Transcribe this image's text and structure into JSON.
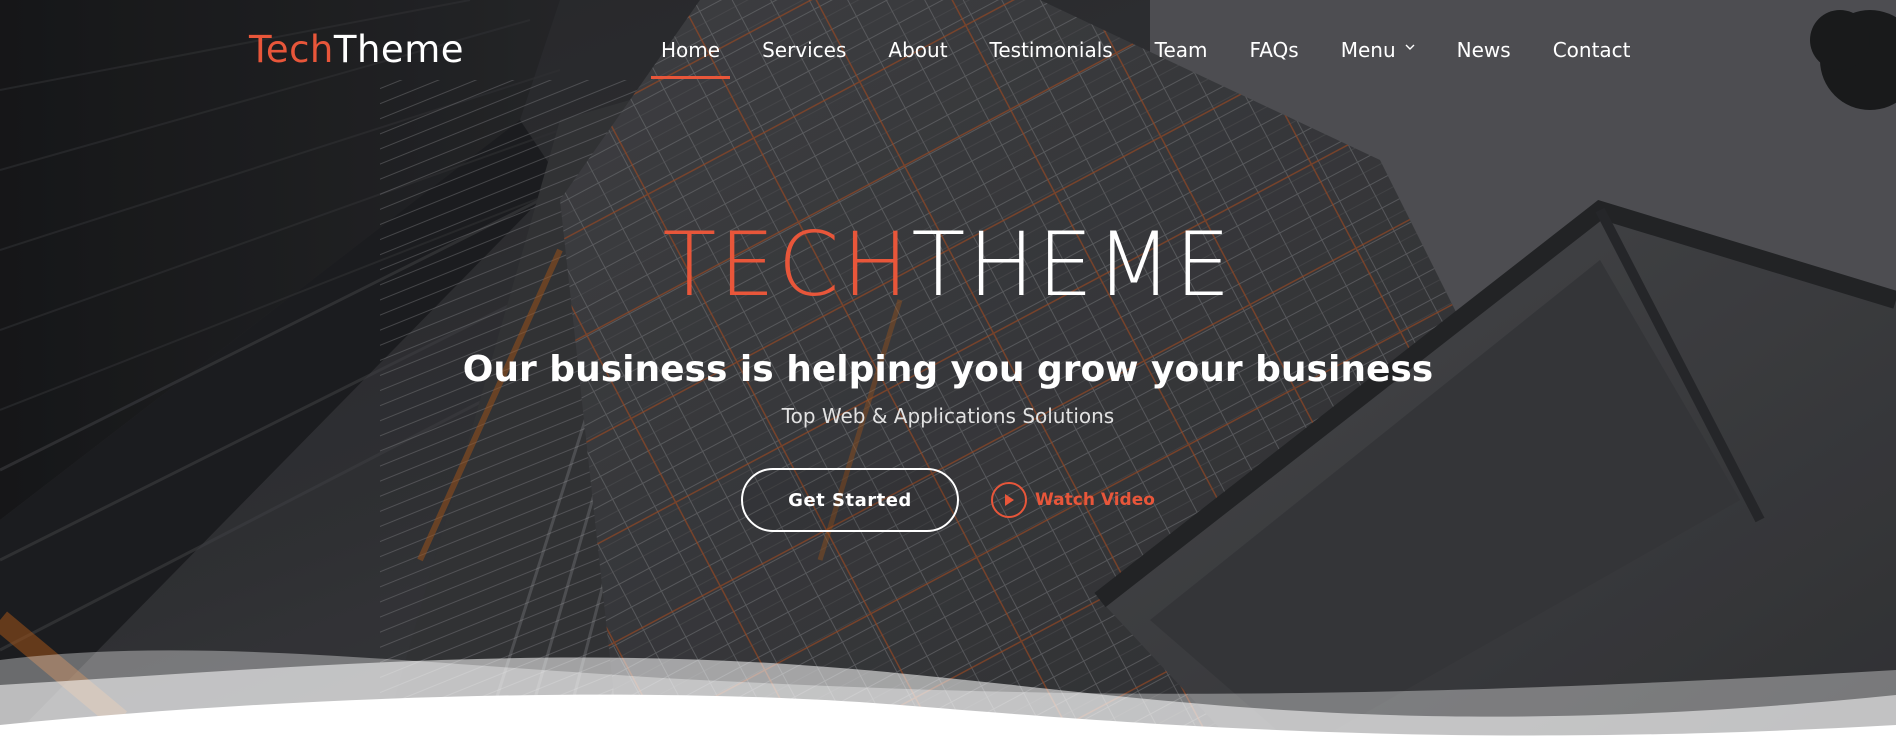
{
  "header": {
    "logo": {
      "accent": "Tech",
      "rest": "Theme"
    },
    "nav": [
      {
        "label": "Home",
        "active": true
      },
      {
        "label": "Services"
      },
      {
        "label": "About"
      },
      {
        "label": "Testimonials"
      },
      {
        "label": "Team"
      },
      {
        "label": "FAQs"
      },
      {
        "label": "Menu",
        "icon": "chevron-down-icon"
      },
      {
        "label": "News"
      },
      {
        "label": "Contact"
      }
    ]
  },
  "hero": {
    "title": {
      "accent": "TECH",
      "rest": "THEME"
    },
    "headline": "Our business is helping you grow your business",
    "subline": "Top Web & Applications Solutions",
    "primary_button": "Get Started",
    "video_link": {
      "label": "Watch Video",
      "icon": "play-icon"
    }
  },
  "colors": {
    "accent": "#e8563a",
    "text": "#ffffff",
    "background_dark": "#2a2b2e",
    "wave": "#e9eaec"
  }
}
